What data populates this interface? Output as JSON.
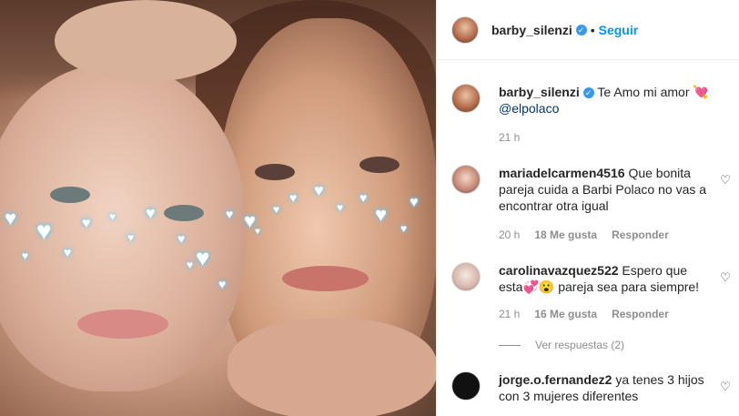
{
  "header": {
    "username": "barby_silenzi",
    "separator": "•",
    "follow_label": "Seguir"
  },
  "caption": {
    "username": "barby_silenzi",
    "text": "Te Amo mi amor 💘",
    "mention": "@elpolaco",
    "time": "21 h"
  },
  "comments": [
    {
      "username": "mariadelcarmen4516",
      "text": "Que bonita pareja cuida a Barbi Polaco no vas a encontrar otra igual",
      "time": "20 h",
      "likes": "18 Me gusta",
      "reply_label": "Responder"
    },
    {
      "username": "carolinavazquez522",
      "text": "Espero que esta💞😮 pareja sea para siempre!",
      "time": "21 h",
      "likes": "16 Me gusta",
      "reply_label": "Responder"
    },
    {
      "username": "jorge.o.fernandez2",
      "text": "ya tenes 3 hijos con 3 mujeres diferentes"
    }
  ],
  "view_replies_label": "Ver respuestas (2)",
  "icons": {
    "verified": "verified-badge-icon",
    "like": "heart-outline-icon"
  },
  "colors": {
    "accent": "#0095f6",
    "verified": "#3897f0",
    "muted": "#8e8e8e"
  }
}
